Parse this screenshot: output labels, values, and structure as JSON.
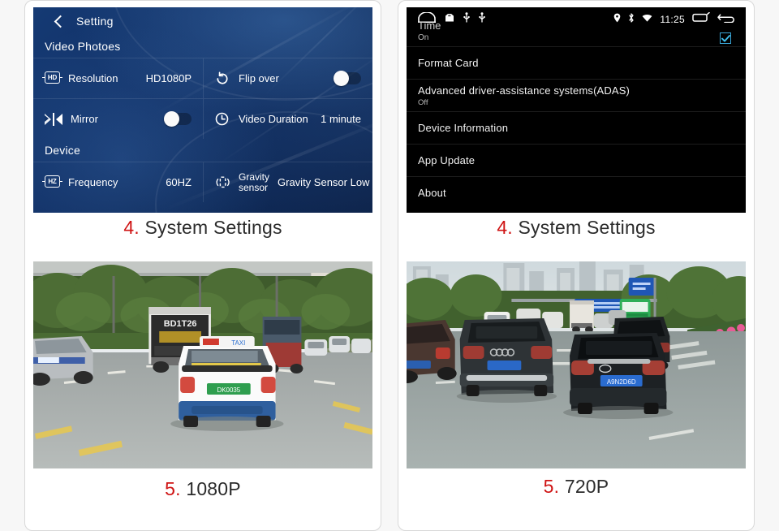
{
  "left_card": {
    "screen": {
      "titlebar": {
        "back_icon": "chevron-left-icon",
        "title": "Setting"
      },
      "sections": [
        {
          "header": "Video Photoes",
          "rows": [
            [
              {
                "icon": "hd-icon",
                "icon_text": "HD",
                "label": "Resolution",
                "value": "HD1080P",
                "type": "value"
              },
              {
                "icon": "rotate-icon",
                "label": "Flip over",
                "value": "",
                "type": "toggle",
                "toggle_on": false
              }
            ],
            [
              {
                "icon": "mirror-icon",
                "label": "Mirror",
                "value": "",
                "type": "toggle",
                "toggle_on": false
              },
              {
                "icon": "clock-icon",
                "label": "Video Duration",
                "value": "1 minute",
                "type": "value"
              }
            ]
          ]
        },
        {
          "header": "Device",
          "rows": [
            [
              {
                "icon": "hz-icon",
                "icon_text": "HZ",
                "label": "Frequency",
                "value": "60HZ",
                "type": "value"
              },
              {
                "icon": "gravity-sensor-icon",
                "label": "Gravity sensor",
                "value": "Gravity Sensor Low",
                "type": "value"
              }
            ]
          ]
        }
      ]
    },
    "caption_top": {
      "num": "4.",
      "text": "System Settings"
    },
    "caption_bottom": {
      "num": "5.",
      "text": "1080P"
    },
    "photo_alt": "dashcam-photo-road-with-white-taxi"
  },
  "right_card": {
    "screen": {
      "statusbar": {
        "left_icons": [
          "home-arch-icon",
          "sdcard-icon",
          "usb-icon",
          "usb-icon"
        ],
        "right_icons": [
          "location-pin-icon",
          "bluetooth-icon",
          "wifi-icon"
        ],
        "time": "11:25",
        "recents_icon": "recents-icon",
        "back_icon": "back-arrow-icon"
      },
      "partial_row": {
        "title": "Time",
        "subtitle": "On",
        "checkbox_icon": "checkmark-icon",
        "checked": true
      },
      "rows": [
        {
          "title": "Format Card",
          "subtitle": ""
        },
        {
          "title": "Advanced driver-assistance systems(ADAS)",
          "subtitle": "Off"
        },
        {
          "title": "Device Information",
          "subtitle": ""
        },
        {
          "title": "App Update",
          "subtitle": ""
        },
        {
          "title": "About",
          "subtitle": ""
        }
      ]
    },
    "caption_top": {
      "num": "4.",
      "text": "System Settings"
    },
    "caption_bottom": {
      "num": "5.",
      "text": "720P"
    },
    "photo_alt": "dashcam-photo-urban-road-with-audi-and-hyundai"
  },
  "colors": {
    "page_background": "#f7f7f7",
    "card_background": "#ffffff",
    "card_border": "#d8d8d8",
    "blue_screen": "#0f2d61",
    "black_screen": "#000000",
    "caption_number": "#cf1313",
    "caption_text": "#2b2b2b",
    "checkbox_accent": "#3aa7d8"
  }
}
